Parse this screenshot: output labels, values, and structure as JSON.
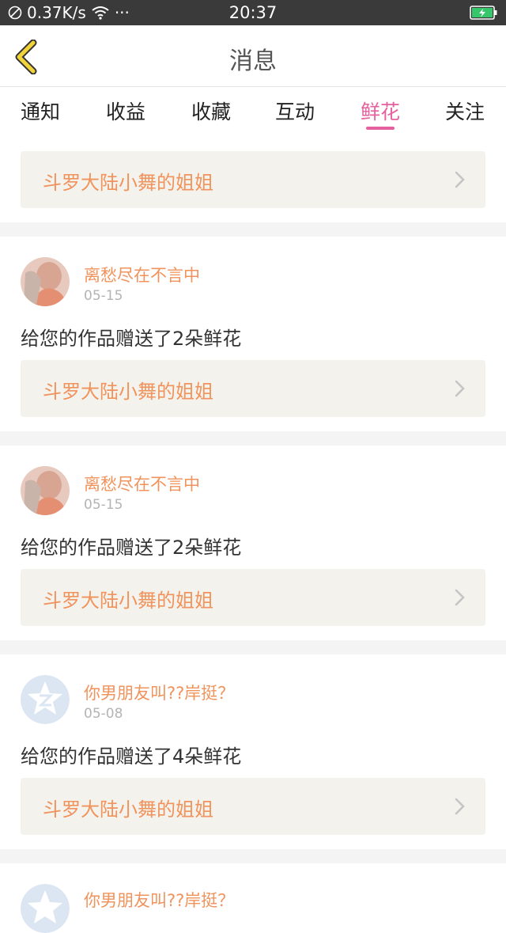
{
  "status_bar": {
    "network_speed": "0.37K/s",
    "dots": "···",
    "time": "20:37"
  },
  "header": {
    "title": "消息"
  },
  "tabs": [
    {
      "label": "通知",
      "active": false
    },
    {
      "label": "收益",
      "active": false
    },
    {
      "label": "收藏",
      "active": false
    },
    {
      "label": "互动",
      "active": false
    },
    {
      "label": "鲜花",
      "active": true
    },
    {
      "label": "关注",
      "active": false
    }
  ],
  "top_card": {
    "work_title": "斗罗大陆小舞的姐姐"
  },
  "messages": [
    {
      "user": "离愁尽在不言中",
      "date": "05-15",
      "text": "给您的作品赠送了2朵鲜花",
      "work_title": "斗罗大陆小舞的姐姐"
    },
    {
      "user": "离愁尽在不言中",
      "date": "05-15",
      "text": "给您的作品赠送了2朵鲜花",
      "work_title": "斗罗大陆小舞的姐姐"
    },
    {
      "user": "你男朋友叫??岸挺？",
      "date": "05-08",
      "text": "给您的作品赠送了4朵鲜花",
      "work_title": "斗罗大陆小舞的姐姐"
    },
    {
      "user": "你男朋友叫??岸挺？"
    }
  ],
  "colors": {
    "accent": "#e5609e",
    "name": "#f0935c",
    "card_bg": "#f3f2ec",
    "back_arrow": "#f2d43a"
  }
}
